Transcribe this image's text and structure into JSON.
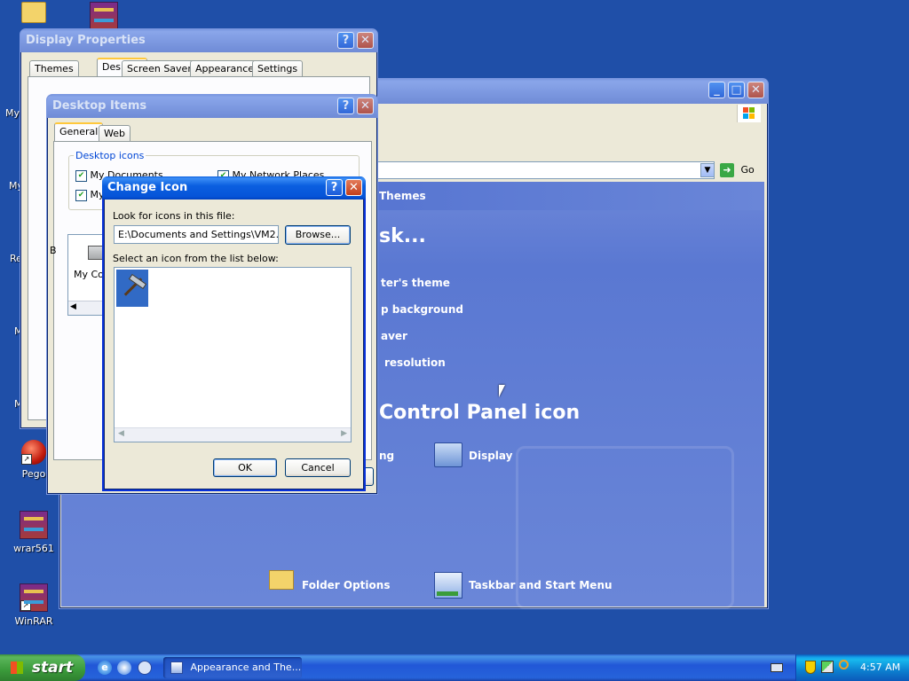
{
  "desktop": {
    "icons": [
      {
        "label": "My Documents (partial)",
        "short": "My"
      },
      {
        "label": "My",
        "short": "My"
      },
      {
        "label": "My",
        "short": "My"
      },
      {
        "label": "Re",
        "short": "Re"
      },
      {
        "label": "M",
        "short": "M"
      },
      {
        "label": "M",
        "short": "M"
      },
      {
        "label": "Pego",
        "short": "Pego"
      },
      {
        "label": "wrar561",
        "short": "wrar561"
      },
      {
        "label": "WinRAR",
        "short": "WinRAR"
      }
    ]
  },
  "control_panel": {
    "themes_link": "Themes",
    "pick_task_heading": "sk...",
    "tasks": [
      "ter's theme",
      "p background",
      "aver",
      "resolution"
    ],
    "pick_icon_heading": "Control Panel icon",
    "items": [
      "ng",
      "Display",
      "Folder Options",
      "Taskbar and Start Menu"
    ],
    "go_label": "Go"
  },
  "display_properties": {
    "title": "Display Properties",
    "tabs": [
      "Themes",
      "Desktop",
      "Screen Saver",
      "Appearance",
      "Settings"
    ],
    "partial_b": "B",
    "partial_mycomputer": "My Co"
  },
  "desktop_items": {
    "title": "Desktop Items",
    "tabs": [
      "General",
      "Web"
    ],
    "group_label": "Desktop icons",
    "checkboxes": [
      "My Documents",
      "My Network Places",
      "My",
      "My"
    ]
  },
  "change_icon": {
    "title": "Change Icon",
    "look_label": "Look for icons in this file:",
    "file_path": "E:\\Documents and Settings\\VM2.COL",
    "browse_label": "Browse...",
    "select_label": "Select an icon from the list below:",
    "ok_label": "OK",
    "cancel_label": "Cancel"
  },
  "taskbar": {
    "start_label": "start",
    "task_label": "Appearance and The...",
    "clock": "4:57 AM"
  }
}
